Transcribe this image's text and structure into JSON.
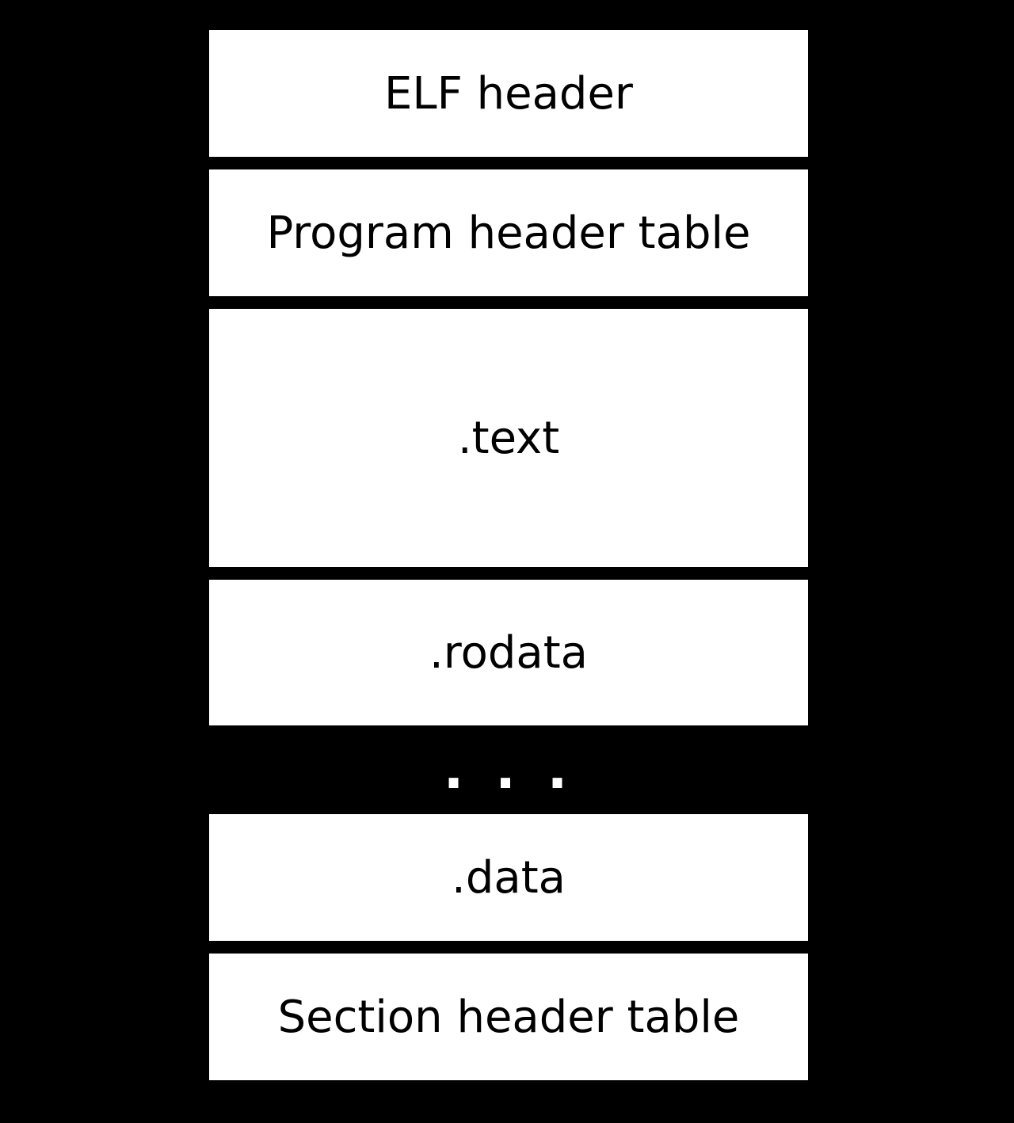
{
  "diagram": {
    "blocks": [
      {
        "label": "ELF header",
        "size": "h-small"
      },
      {
        "label": "Program header table",
        "size": "h-small"
      },
      {
        "label": ".text",
        "size": "h-large"
      },
      {
        "label": ".rodata",
        "size": "h-med"
      }
    ],
    "gap_label": ". . .",
    "blocks_after": [
      {
        "label": ".data",
        "size": "h-small"
      },
      {
        "label": "Section header table",
        "size": "h-small"
      }
    ]
  }
}
